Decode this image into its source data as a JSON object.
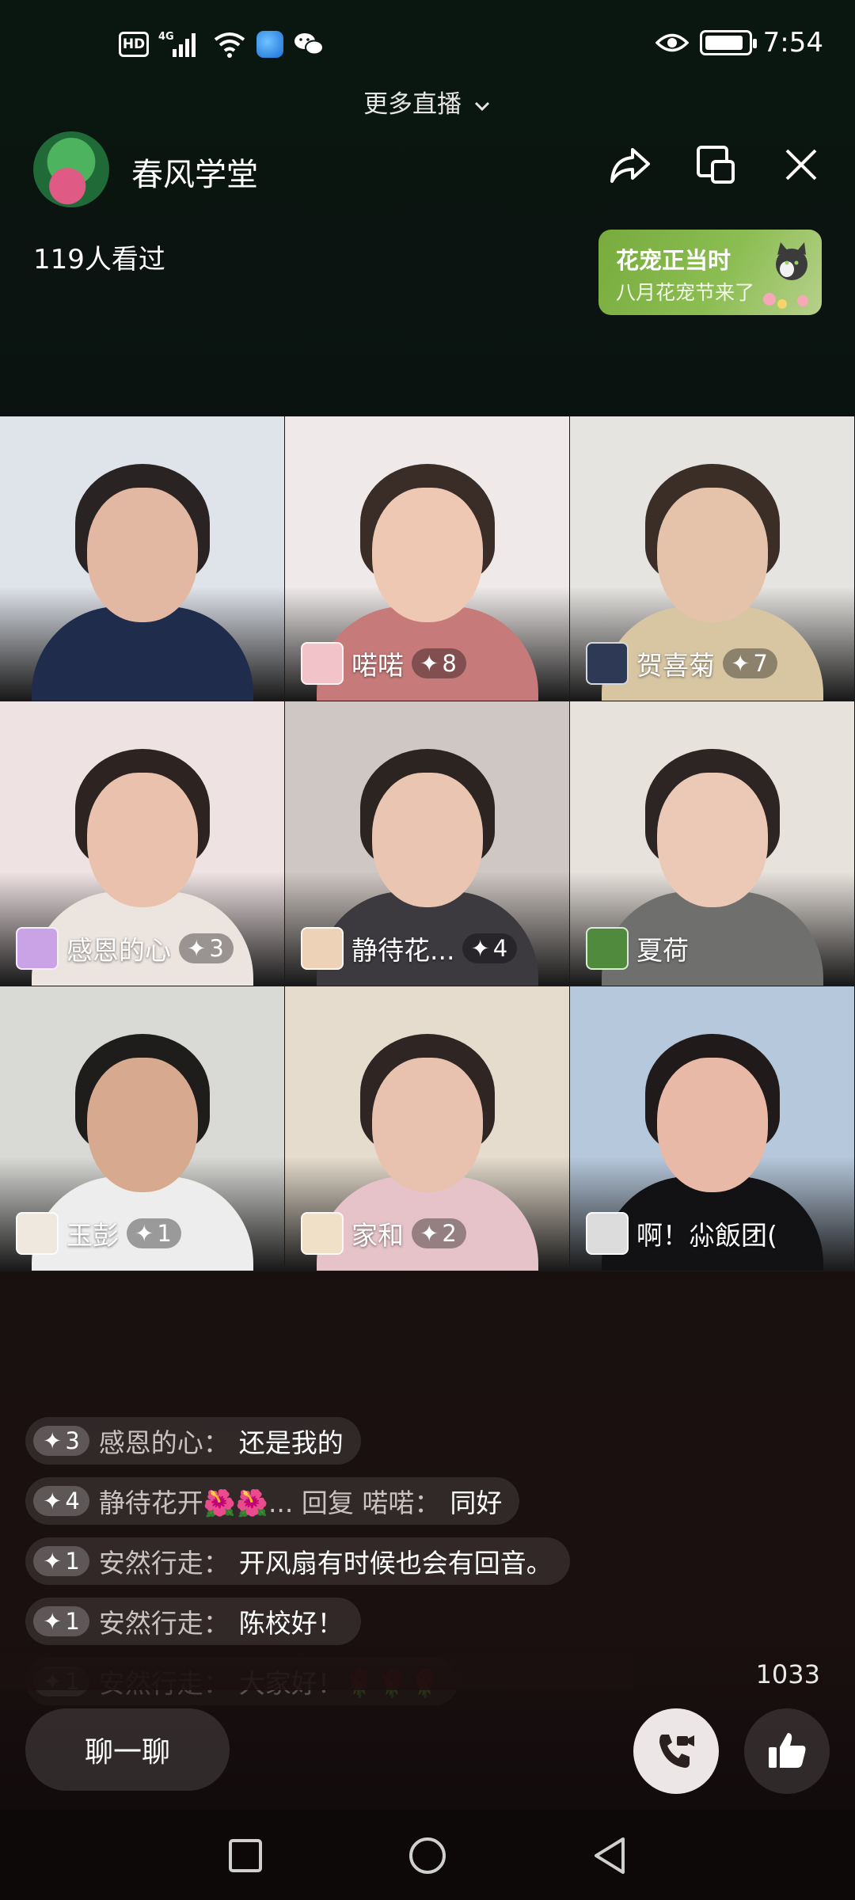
{
  "status_bar": {
    "hd": "HD",
    "network": "4G",
    "time": "7:54",
    "battery_level": 0.9
  },
  "header": {
    "more_live": "更多直播",
    "room_name": "春风学堂",
    "viewers": "119人看过",
    "promo": {
      "title": "花宠正当时",
      "subtitle": "八月花宠节来了"
    }
  },
  "tiles": [
    {
      "name": "",
      "level": "",
      "colors": {
        "bg": "#dfe3ea",
        "shirt": "#1f2c4c",
        "skin": "#e3b8a3",
        "hair": "#2a2323"
      }
    },
    {
      "name": "喏喏",
      "level": "8",
      "colors": {
        "bg": "#efeae9",
        "shirt": "#c77a7a",
        "skin": "#efc8b4",
        "hair": "#3a2c26",
        "avatar": "#f2c3c9"
      }
    },
    {
      "name": "贺喜菊",
      "level": "7",
      "colors": {
        "bg": "#e6e4e1",
        "shirt": "#d8c6a3",
        "skin": "#e5c3ab",
        "hair": "#3b2e27",
        "avatar": "#2e3a55"
      }
    },
    {
      "name": "感恩的心",
      "level": "3",
      "colors": {
        "bg": "#efe2e3",
        "shirt": "#ece4df",
        "skin": "#e9c1ad",
        "hair": "#2d2422",
        "avatar": "#c9a3e6"
      }
    },
    {
      "name": "静待花...",
      "level": "4",
      "colors": {
        "bg": "#cfc7c3",
        "shirt": "#3c3a3f",
        "skin": "#e9c5b2",
        "hair": "#2c2421",
        "avatar": "#eed2b8"
      }
    },
    {
      "name": "夏荷",
      "level": "",
      "colors": {
        "bg": "#e8e2dc",
        "shirt": "#6f706e",
        "skin": "#ecc9b6",
        "hair": "#2c2523",
        "avatar": "#4f8a3d"
      }
    },
    {
      "name": "玉彭",
      "level": "1",
      "colors": {
        "bg": "#d9d9d6",
        "shirt": "#ededed",
        "skin": "#d7a98f",
        "hair": "#1f1c1c",
        "avatar": "#efe8de"
      }
    },
    {
      "name": "家和",
      "level": "2",
      "colors": {
        "bg": "#e6dccd",
        "shirt": "#e6c3c8",
        "skin": "#e8c2ae",
        "hair": "#2f2522",
        "avatar": "#efe0c7"
      }
    },
    {
      "name": "啊！尛飯团(...",
      "level": "",
      "colors": {
        "bg": "#b6c8dc",
        "shirt": "#121214",
        "skin": "#e7b9a6",
        "hair": "#201a1a",
        "avatar": "#dcdcdc"
      }
    }
  ],
  "chat": [
    {
      "level": "3",
      "user": "感恩的心：",
      "text": "还是我的"
    },
    {
      "level": "4",
      "user": "静待花开🌺🌺... 回复 喏喏：",
      "text": "同好"
    },
    {
      "level": "1",
      "user": "安然行走：",
      "text": "开风扇有时候也会有回音。"
    },
    {
      "level": "1",
      "user": "安然行走：",
      "text": "陈校好！"
    },
    {
      "level": "1",
      "user": "安然行走：",
      "text": "大家好！🌹🌹🌹"
    }
  ],
  "bottom": {
    "like_count": "1033",
    "chat_label": "聊一聊"
  }
}
